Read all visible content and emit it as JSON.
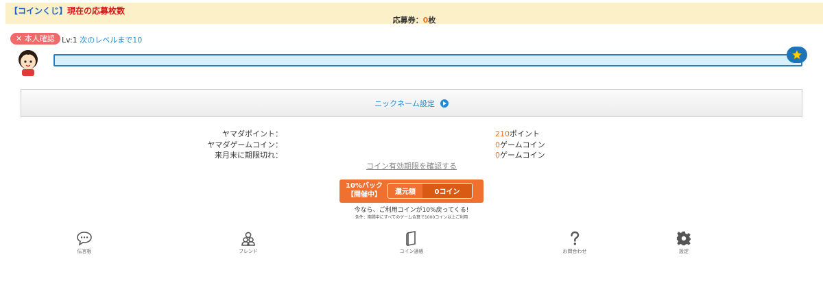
{
  "banner": {
    "title_bracket": "【コインくじ】",
    "title_text": "現在の応募枚数",
    "ticket_label": "応募券：",
    "ticket_count": "0",
    "ticket_unit": "枚"
  },
  "profile": {
    "verify_badge": "✕ 本人確認",
    "level": "Lv:1",
    "next_level": "次のレベルまで10",
    "progress_fraction": 0
  },
  "nickname": {
    "label": "ニックネーム設定"
  },
  "stats": [
    {
      "label": "ヤマダポイント：",
      "value": "210",
      "unit": "ポイント"
    },
    {
      "label": "ヤマダゲームコイン：",
      "value": "0",
      "unit": "ゲームコイン"
    },
    {
      "label": "来月末に期限切れ：",
      "value": "0",
      "unit": "ゲームコイン"
    }
  ],
  "expiry_link": "コイン有効期限を確認する",
  "cashback": {
    "campaign_line1": "10%バック",
    "campaign_line2": "【開催中】",
    "amount_label": "還元額",
    "amount_value": "0コイン",
    "message": "今なら、ご利用コインが10%戻ってくる!",
    "condition": "条件：期間中にすべてのゲーム合算で1000コイン以上ご利用"
  },
  "bottom_nav": [
    {
      "label": "伝言板",
      "icon": "chat-bubble-icon"
    },
    {
      "label": "フレンド",
      "icon": "friends-icon"
    },
    {
      "label": "コイン通帳",
      "icon": "passbook-icon"
    },
    {
      "label": "お問合わせ",
      "icon": "question-icon"
    },
    {
      "label": "設定",
      "icon": "gear-icon"
    }
  ],
  "colors": {
    "accent_blue": "#1e8cd2",
    "accent_orange": "#f07020",
    "banner_bg": "#fcf0c8",
    "badge_red": "#f06a6a"
  }
}
